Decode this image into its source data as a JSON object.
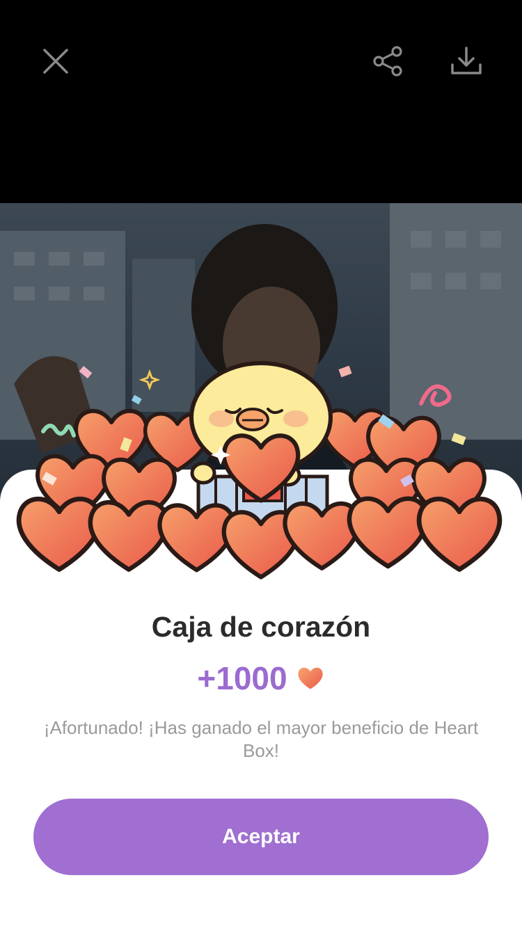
{
  "topbar": {
    "close_icon": "close-icon",
    "share_icon": "share-icon",
    "download_icon": "download-icon"
  },
  "dialog": {
    "title": "Caja de corazón",
    "amount": "+1000",
    "amount_icon": "heart-icon",
    "description": "¡Afortunado! ¡Has ganado el mayor beneficio de Heart Box!",
    "accept_label": "Aceptar"
  },
  "colors": {
    "accent": "#a06fd1",
    "amount": "#9b6bd0",
    "heart": "#ef6c57",
    "title": "#2b2b2b",
    "description": "#9a9a9a"
  }
}
